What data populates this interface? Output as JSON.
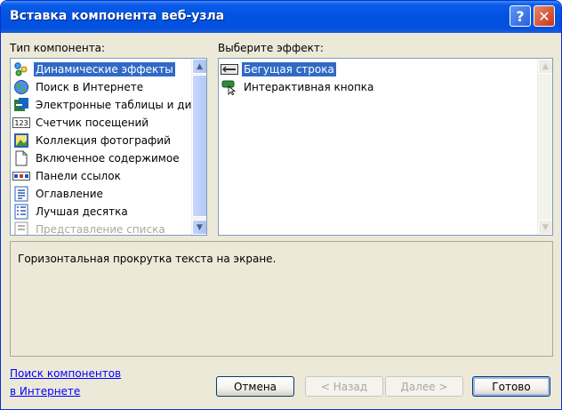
{
  "window": {
    "title": "Вставка компонента веб-узла",
    "help_label": "?",
    "close_label": "✕"
  },
  "left_panel": {
    "label": "Тип компонента:",
    "items": [
      {
        "label": "Динамические эффекты",
        "icon": "dynamic-effects-icon",
        "selected": true
      },
      {
        "label": "Поиск в Интернете",
        "icon": "globe-icon"
      },
      {
        "label": "Электронные таблицы и ди",
        "icon": "spreadsheet-icon"
      },
      {
        "label": "Счетчик посещений",
        "icon": "counter-icon"
      },
      {
        "label": "Коллекция фотографий",
        "icon": "photo-gallery-icon"
      },
      {
        "label": "Включенное содержимое",
        "icon": "document-icon"
      },
      {
        "label": "Панели ссылок",
        "icon": "link-bar-icon"
      },
      {
        "label": "Оглавление",
        "icon": "table-of-contents-icon"
      },
      {
        "label": "Лучшая десятка",
        "icon": "top-ten-icon"
      },
      {
        "label": "Представление списка",
        "icon": "list-view-icon",
        "disabled": true
      }
    ]
  },
  "right_panel": {
    "label": "Выберите эффект:",
    "items": [
      {
        "label": "Бегущая строка",
        "icon": "marquee-icon",
        "selected": true
      },
      {
        "label": "Интерактивная кнопка",
        "icon": "interactive-button-icon"
      }
    ]
  },
  "description": "Горизонтальная прокрутка текста на экране.",
  "find_link": {
    "line1": "Поиск компонентов",
    "line2": "в Интернете"
  },
  "buttons": {
    "cancel": "Отмена",
    "back": "< Назад",
    "next": "Далее >",
    "finish": "Готово"
  },
  "scroll": {
    "up": "▲",
    "down": "▼"
  }
}
